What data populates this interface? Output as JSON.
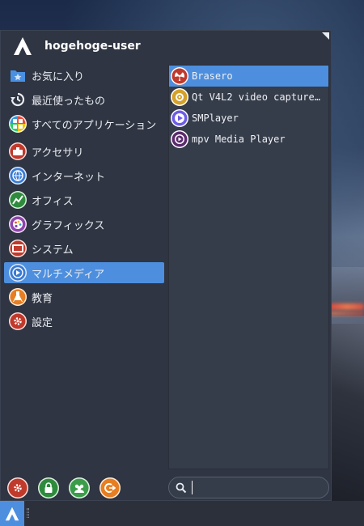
{
  "user": {
    "name": "hogehoge-user"
  },
  "categories": [
    {
      "label": "お気に入り",
      "icon": "favorites-folder-icon",
      "color": "#4a90e2"
    },
    {
      "label": "最近使ったもの",
      "icon": "history-icon",
      "color": "#e8ecf2"
    },
    {
      "label": "すべてのアプリケーション",
      "icon": "all-apps-icon",
      "color": "#e74c3c"
    },
    {
      "label": "アクセサリ",
      "icon": "accessories-icon",
      "color": "#c0392b"
    },
    {
      "label": "インターネット",
      "icon": "internet-icon",
      "color": "#3a7bd5"
    },
    {
      "label": "オフィス",
      "icon": "office-icon",
      "color": "#2e8b3d"
    },
    {
      "label": "グラフィックス",
      "icon": "graphics-icon",
      "color": "#8e44ad"
    },
    {
      "label": "システム",
      "icon": "system-icon",
      "color": "#c0392b"
    },
    {
      "label": "マルチメディア",
      "icon": "multimedia-icon",
      "color": "#3a7bd5"
    },
    {
      "label": "教育",
      "icon": "education-icon",
      "color": "#e67e22"
    },
    {
      "label": "設定",
      "icon": "settings-icon",
      "color": "#c0392b"
    }
  ],
  "apps": [
    {
      "label": "Brasero",
      "icon": "brasero-icon",
      "color": "#c0392b"
    },
    {
      "label": "Qt V4L2 video capture…",
      "icon": "qt-v4l2-icon",
      "color": "#d4a12a"
    },
    {
      "label": "SMPlayer",
      "icon": "smplayer-icon",
      "color": "#6c5ce7"
    },
    {
      "label": "mpv Media Player",
      "icon": "mpv-icon",
      "color": "#5b2a6e"
    }
  ],
  "actions": [
    {
      "icon": "settings-gear-icon",
      "color": "#c0392b"
    },
    {
      "icon": "lock-icon",
      "color": "#2e8b3d"
    },
    {
      "icon": "users-icon",
      "color": "#3b9d4a"
    },
    {
      "icon": "logout-icon",
      "color": "#e67e22"
    }
  ],
  "search": {
    "value": "",
    "placeholder": ""
  },
  "colors": {
    "accent": "#4d8fde",
    "panel": "#2f3542",
    "list": "#353c4a"
  }
}
